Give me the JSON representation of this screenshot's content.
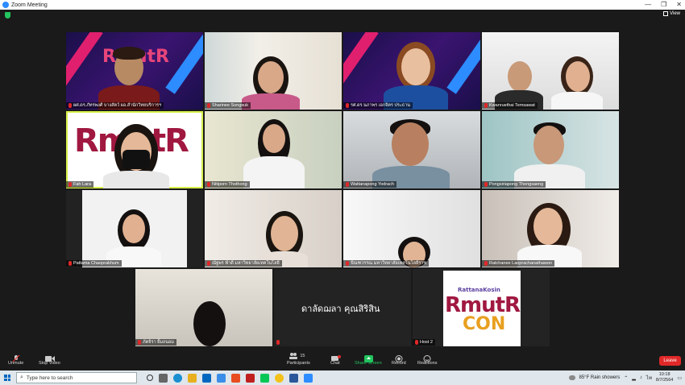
{
  "window": {
    "title": "Zoom Meeting",
    "view_label": "View"
  },
  "participants": [
    {
      "name": "ผศ.ดร.ภัทรพงศ์ บางสัตว์ ผอ.สำนักวิทยบริการฯ"
    },
    {
      "name": "Sharinee Songsuk"
    },
    {
      "name": "รศ.ดร.นภาพร เอกจิตร ประธาน"
    },
    {
      "name": "Kwanruethai Temsawat"
    },
    {
      "name": "Fah Lara"
    },
    {
      "name": "Nitiporn Thothong"
    },
    {
      "name": "Wattanapong Yodrach"
    },
    {
      "name": "Pongsiriapong Thongsaeng"
    },
    {
      "name": "Pattama Chaoprakhum"
    },
    {
      "name": "ณัฐพร ฟ้าดี มหาวิทยาลัยเทคโนโลยี"
    },
    {
      "name": "ปัณฑวรรณ มหาวิทยาลัยเทคโนโลยีราช"
    },
    {
      "name": "Ratchanee Laoprachanathawon"
    },
    {
      "name": "ภัคจิรา ยิ้มถนอม"
    },
    {
      "name": "ดาลัดฌลา คุณสิริสิน"
    },
    {
      "name": "Host 2"
    }
  ],
  "event_logo": {
    "text_top": "RattanaKosin",
    "text_mid": "RmutR",
    "text_bot": "CON"
  },
  "toolbar": {
    "unmute": "Unmute",
    "stop_video": "Stop Video",
    "participants": "Participants",
    "participant_count": "15",
    "chat": "Chat",
    "share_screen": "Share Screen",
    "record": "Record",
    "reactions": "Reactions",
    "leave": "Leave"
  },
  "taskbar": {
    "search_placeholder": "Type here to search",
    "weather": "85°F  Rain showers",
    "time": "10:18",
    "date": "8/7/2564"
  },
  "colors": {
    "accent_green": "#22c55e",
    "leave_red": "#e02828",
    "active_speaker": "#d8f04a",
    "zoom_blue": "#2d8cff"
  }
}
